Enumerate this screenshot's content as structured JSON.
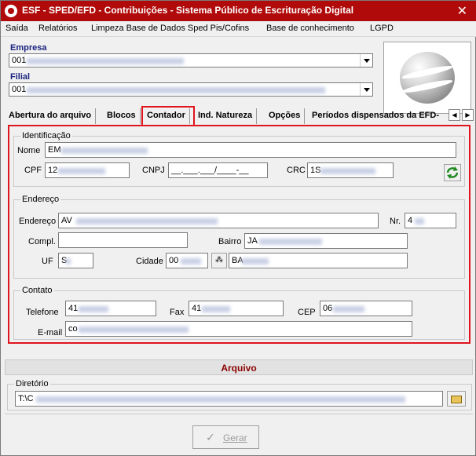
{
  "window": {
    "title": "ESF - SPED/EFD - Contribuições - Sistema Público de Escrituração Digital",
    "close_glyph": "✕"
  },
  "menu": {
    "items": [
      "Saída",
      "Relatórios",
      "Limpeza Base de Dados Sped Pis/Cofins",
      "Base de conhecimento",
      "LGPD"
    ]
  },
  "header": {
    "empresa_label": "Empresa",
    "empresa_value": "001",
    "filial_label": "Filial",
    "filial_value": "001"
  },
  "tabs": {
    "items": [
      "Abertura do arquivo",
      "Blocos",
      "Contador",
      "Ind. Natureza",
      "Opções",
      "Períodos dispensados da EFD-"
    ],
    "active": "Contador",
    "scroll_left": "◀",
    "scroll_right": "▶"
  },
  "identificacao": {
    "group_title": "Identificação",
    "nome_label": "Nome",
    "nome_value": "EM",
    "cpf_label": "CPF",
    "cpf_value": "12",
    "cnpj_label": "CNPJ",
    "cnpj_value": "__.___.___/____-__",
    "crc_label": "CRC",
    "crc_value": "1S"
  },
  "endereco": {
    "group_title": "Endereço",
    "endereco_label": "Endereço",
    "endereco_value": "AV",
    "nr_label": "Nr.",
    "nr_value": "4",
    "compl_label": "Compl.",
    "compl_value": "",
    "bairro_label": "Bairro",
    "bairro_value": "JA",
    "uf_label": "UF",
    "uf_value": "S",
    "cidade_label": "Cidade",
    "cidade_code": "00",
    "cidade_name": "BA",
    "binoculars_glyph": "⁂"
  },
  "contato": {
    "group_title": "Contato",
    "telefone_label": "Telefone",
    "telefone_value": "41",
    "fax_label": "Fax",
    "fax_value": "41",
    "cep_label": "CEP",
    "cep_value": "06",
    "email_label": "E-mail",
    "email_value": "co"
  },
  "arquivo": {
    "title": "Arquivo",
    "diretorio_label": "Diretório",
    "diretorio_value": "T:\\C"
  },
  "actions": {
    "gerar_label": "Gerar",
    "gerar_icon": "✓",
    "gerar_enabled": false
  },
  "colors": {
    "titlebar": "#b10a0a",
    "highlight": "#e0141e",
    "label_blue": "#1a237e",
    "arquivo_title": "#8b0000"
  }
}
